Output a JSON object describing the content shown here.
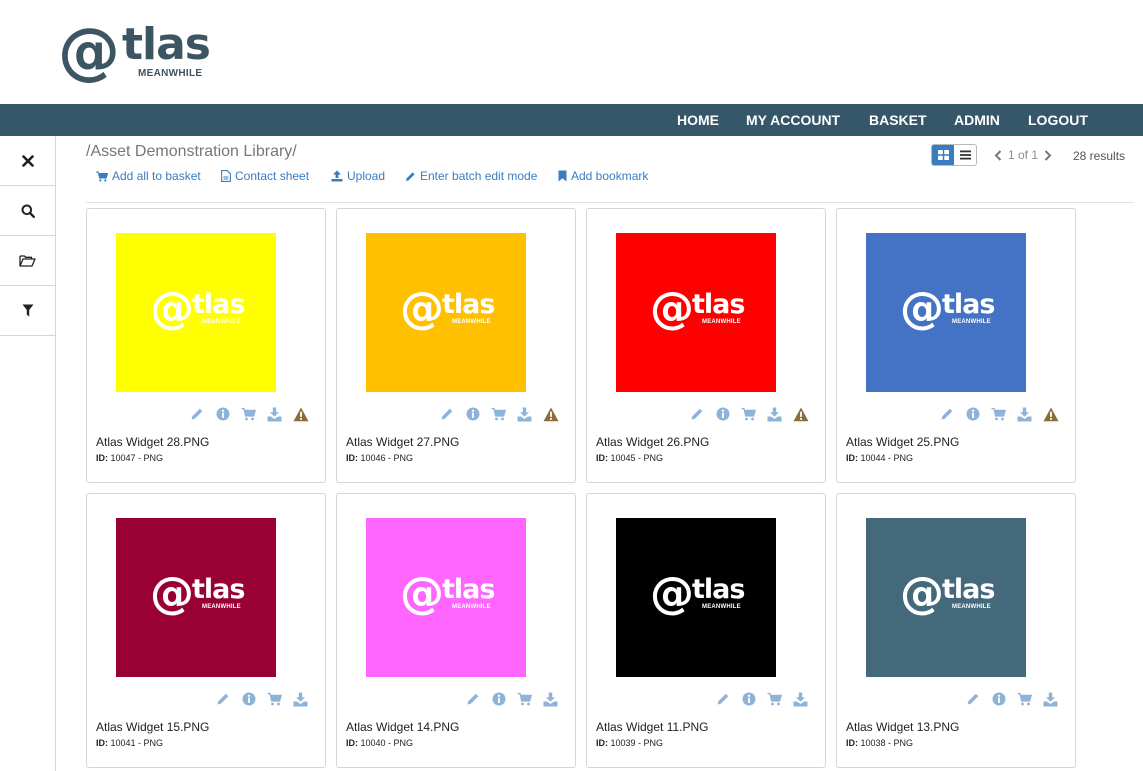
{
  "logo": {
    "mark": "@",
    "word": "tlas",
    "tagline": "MEANWHILE"
  },
  "nav": {
    "home": "HOME",
    "account": "MY ACCOUNT",
    "basket": "BASKET",
    "admin": "ADMIN",
    "logout": "LOGOUT"
  },
  "sidebar": {
    "items": [
      "close-icon",
      "search-icon",
      "folder-open-icon",
      "filter-icon"
    ]
  },
  "breadcrumb": "/Asset Demonstration Library/",
  "toolbar": {
    "add_all": "Add all to basket",
    "contact_sheet": "Contact sheet",
    "upload": "Upload",
    "batch_edit": "Enter batch edit mode",
    "bookmark": "Add bookmark"
  },
  "pager": {
    "page": "1 of 1",
    "results": "28 results"
  },
  "thumb_logo": {
    "mark": "@",
    "word": "tlas",
    "tagline": "MEANWHILE"
  },
  "colors": {
    "nav": "#355769",
    "link": "#3a7cc0",
    "warning": "#8a6d3b",
    "icon": "#8fb3d8"
  },
  "assets": [
    {
      "name": "Atlas Widget 28.PNG",
      "id_label": "ID:",
      "id_text": " 10047 - PNG",
      "color": "#ffff00",
      "warning": true
    },
    {
      "name": "Atlas Widget 27.PNG",
      "id_label": "ID:",
      "id_text": " 10046 - PNG",
      "color": "#ffc000",
      "warning": true
    },
    {
      "name": "Atlas Widget 26.PNG",
      "id_label": "ID:",
      "id_text": " 10045 - PNG",
      "color": "#ff0000",
      "warning": true
    },
    {
      "name": "Atlas Widget 25.PNG",
      "id_label": "ID:",
      "id_text": " 10044 - PNG",
      "color": "#4472c4",
      "warning": true
    },
    {
      "name": "Atlas Widget 15.PNG",
      "id_label": "ID:",
      "id_text": " 10041 - PNG",
      "color": "#990033",
      "warning": false
    },
    {
      "name": "Atlas Widget 14.PNG",
      "id_label": "ID:",
      "id_text": " 10040 - PNG",
      "color": "#ff66ff",
      "warning": false
    },
    {
      "name": "Atlas Widget 11.PNG",
      "id_label": "ID:",
      "id_text": " 10039 - PNG",
      "color": "#000000",
      "warning": false
    },
    {
      "name": "Atlas Widget 13.PNG",
      "id_label": "ID:",
      "id_text": " 10038 - PNG",
      "color": "#44697b",
      "warning": false
    }
  ]
}
